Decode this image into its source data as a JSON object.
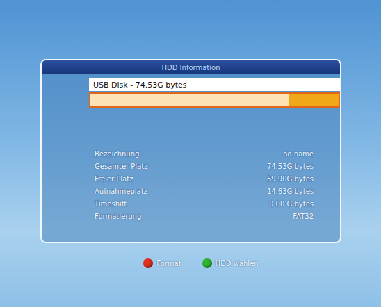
{
  "window": {
    "title": "HDD Information"
  },
  "disk": {
    "label": "USB Disk - 74.53G bytes",
    "level": 0.2
  },
  "info": [
    {
      "label": "Bezeichnung",
      "value": "no name"
    },
    {
      "label": "Gesamter Platz",
      "value": "74.53G bytes"
    },
    {
      "label": "Freier Platz",
      "value": "59.90G bytes"
    },
    {
      "label": "Aufnahmeplatz",
      "value": "14.63G bytes"
    },
    {
      "label": "Timeshift",
      "value": "0.00 G bytes"
    },
    {
      "label": "Formatierung",
      "value": "FAT32"
    }
  ],
  "buttons": [
    {
      "label": "Format",
      "color": "#e0301e"
    },
    {
      "label": "HDD wählen",
      "color": "#2fb52f"
    }
  ]
}
